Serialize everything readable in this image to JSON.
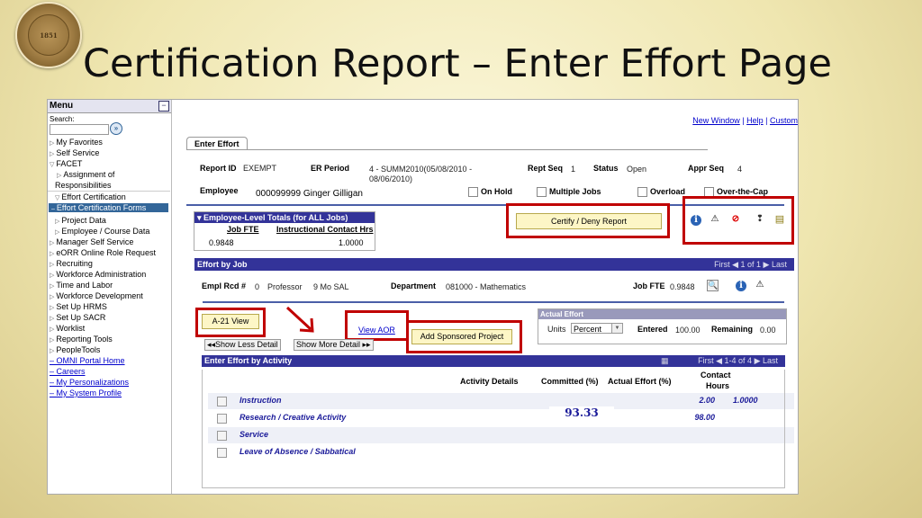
{
  "slide": {
    "title": "Certification Report – Enter Effort Page",
    "seal_text": "FLORIDA STATE UNIVERSITY 1851"
  },
  "menu": {
    "title": "Menu",
    "search_label": "Search:",
    "items": [
      {
        "label": "My Favorites",
        "tri": "▷"
      },
      {
        "label": "Self Service",
        "tri": "▷"
      },
      {
        "label": "FACET",
        "tri": "▽"
      },
      {
        "label": "Assignment of",
        "tri": "▷"
      },
      {
        "label": "Responsibilities",
        "tri": ""
      },
      {
        "label": "Effort Certification",
        "tri": "▽"
      },
      {
        "label": "Effort Certification Forms",
        "tri": "–"
      },
      {
        "label": "Project Data",
        "tri": "▷"
      },
      {
        "label": "Employee / Course Data",
        "tri": "▷"
      },
      {
        "label": "Manager Self Service",
        "tri": "▷"
      },
      {
        "label": "eORR Online Role Request",
        "tri": "▷"
      },
      {
        "label": "Recruiting",
        "tri": "▷"
      },
      {
        "label": "Workforce Administration",
        "tri": "▷"
      },
      {
        "label": "Time and Labor",
        "tri": "▷"
      },
      {
        "label": "Workforce Development",
        "tri": "▷"
      },
      {
        "label": "Set Up HRMS",
        "tri": "▷"
      },
      {
        "label": "Set Up SACR",
        "tri": "▷"
      },
      {
        "label": "Worklist",
        "tri": "▷"
      },
      {
        "label": "Reporting Tools",
        "tri": "▷"
      },
      {
        "label": "PeopleTools",
        "tri": "▷"
      }
    ],
    "links": [
      "OMNI Portal Home",
      "Careers",
      "My Personalizations",
      "My System Profile"
    ]
  },
  "toplinks": {
    "new_window": "New Window",
    "help": "Help",
    "customize": "Custom"
  },
  "tab_label": "Enter Effort",
  "header": {
    "report_id_label": "Report ID",
    "report_id": "EXEMPT",
    "er_period_label": "ER Period",
    "er_period_line1": "4 - SUMM2010(05/08/2010 -",
    "er_period_line2": "08/06/2010)",
    "rept_seq_label": "Rept Seq",
    "rept_seq": "1",
    "status_label": "Status",
    "status": "Open",
    "appr_seq_label": "Appr Seq",
    "appr_seq": "4",
    "employee_label": "Employee",
    "employee": "000099999 Ginger Gilligan",
    "on_hold": "On Hold",
    "multiple_jobs": "Multiple Jobs",
    "overload": "Overload",
    "over_the_cap": "Over-the-Cap"
  },
  "totals": {
    "title": "▾ Employee-Level Totals (for ALL Jobs)",
    "col1": "Job FTE",
    "col2": "Instructional Contact Hrs",
    "job_fte": "0.9848",
    "contact_hrs": "1.0000"
  },
  "certify_button": "Certify / Deny Report",
  "effort_by_job": {
    "title": "Effort by Job",
    "nav": "First ◀ 1 of 1 ▶ Last",
    "empl_rcd_label": "Empl Rcd #",
    "empl_rcd": "0",
    "position": "Professor",
    "position_type": "9 Mo SAL",
    "dept_label": "Department",
    "dept": "081000 - Mathematics",
    "job_fte_label": "Job FTE",
    "job_fte": "0.9848"
  },
  "a21_button": "A-21 View",
  "view_aor": "View AOR",
  "add_project_button": "Add Sponsored Project",
  "show_less": "◂◂Show Less Detail",
  "show_more": "Show More Detail ▸▸",
  "actual_effort": {
    "title": "Actual Effort",
    "units_label": "Units",
    "units_value": "Percent",
    "entered_label": "Entered",
    "entered": "100.00",
    "remaining_label": "Remaining",
    "remaining": "0.00"
  },
  "activity_grid": {
    "title": "Enter Effort by Activity",
    "nav": "First ◀ 1-4 of 4 ▶ Last",
    "col_details": "Activity Details",
    "col_committed": "Committed (%)",
    "col_actual": "Actual Effort (%)",
    "col_contact": "Contact",
    "col_hours": "Hours",
    "rows": [
      {
        "activity": "Instruction",
        "committed": "",
        "actual": "2.00",
        "hours": "1.0000"
      },
      {
        "activity": "Research / Creative Activity",
        "committed": "93.33",
        "actual": "98.00",
        "hours": ""
      },
      {
        "activity": "Service",
        "committed": "",
        "actual": "",
        "hours": ""
      },
      {
        "activity": "Leave of Absence / Sabbatical",
        "committed": "",
        "actual": "",
        "hours": ""
      }
    ]
  },
  "colors": {
    "band": "#333399",
    "highlight": "#c00000",
    "button": "#fdf6c6"
  }
}
